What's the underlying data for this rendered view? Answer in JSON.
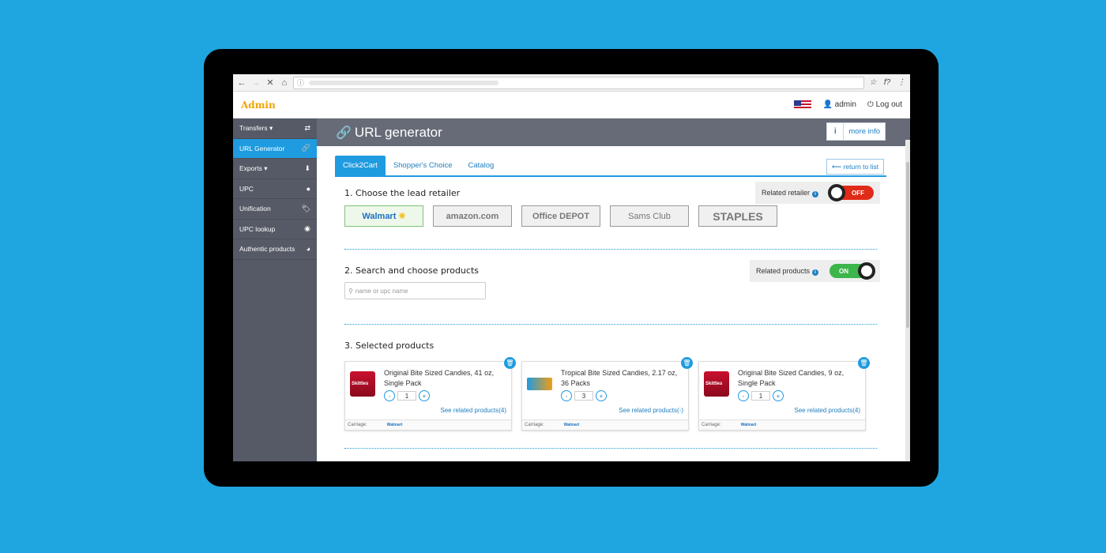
{
  "browser": {
    "star": "☆",
    "ext": "f?",
    "menu": "⋮"
  },
  "app": {
    "brand": "Admin",
    "user": "admin",
    "logout": "Log out"
  },
  "sidebar": {
    "items": [
      {
        "label": "Transfers",
        "caret": "▾",
        "icon": "⇄"
      },
      {
        "label": "URL Generator",
        "caret": "",
        "icon": "🔗"
      },
      {
        "label": "Exports",
        "caret": "▾",
        "icon": "⬇"
      },
      {
        "label": "UPC",
        "caret": "",
        "icon": "●"
      },
      {
        "label": "Unification",
        "caret": "",
        "icon": "🏷"
      },
      {
        "label": "UPC lookup",
        "caret": "",
        "icon": "◉"
      },
      {
        "label": "Authentic products",
        "caret": "",
        "icon": "◕"
      }
    ]
  },
  "page": {
    "title": "URL generator",
    "more_info": "more info",
    "info_glyph": "i"
  },
  "tabs": [
    "Click2Cart",
    "Shopper's Choice",
    "Catalog"
  ],
  "return_label": "⟵ return to list",
  "step1": {
    "title": "1. Choose the lead retailer",
    "toggle_label": "Related retailer",
    "toggle_state": "OFF",
    "retailers": [
      "Walmart",
      "amazon.com",
      "Office DEPOT",
      "Sams Club",
      "STAPLES"
    ]
  },
  "step2": {
    "title": "2. Search and choose products",
    "toggle_label": "Related products",
    "toggle_state": "ON",
    "search_placeholder": "name or upc name"
  },
  "step3": {
    "title": "3. Selected products",
    "products": [
      {
        "name": "Original Bite Sized Candies, 41 oz, Single Pack",
        "qty": "1",
        "related": "See related products(4)",
        "carriage_label": "Carriage:",
        "carriage_retailer": "Walmart"
      },
      {
        "name": "Tropical Bite Sized Candies, 2.17 oz, 36 Packs",
        "qty": "3",
        "related": "See related products(-)",
        "carriage_label": "Carriage:",
        "carriage_retailer": "Walmart"
      },
      {
        "name": "Original Bite Sized Candies, 9 oz, Single Pack",
        "qty": "1",
        "related": "See related products(4)",
        "carriage_label": "Carriage:",
        "carriage_retailer": "Walmart"
      }
    ]
  },
  "colors": {
    "accent": "#1f9be0",
    "brand": "#f0a500",
    "sidebar": "#555a66",
    "on": "#3cb54a",
    "off": "#e02b18"
  }
}
